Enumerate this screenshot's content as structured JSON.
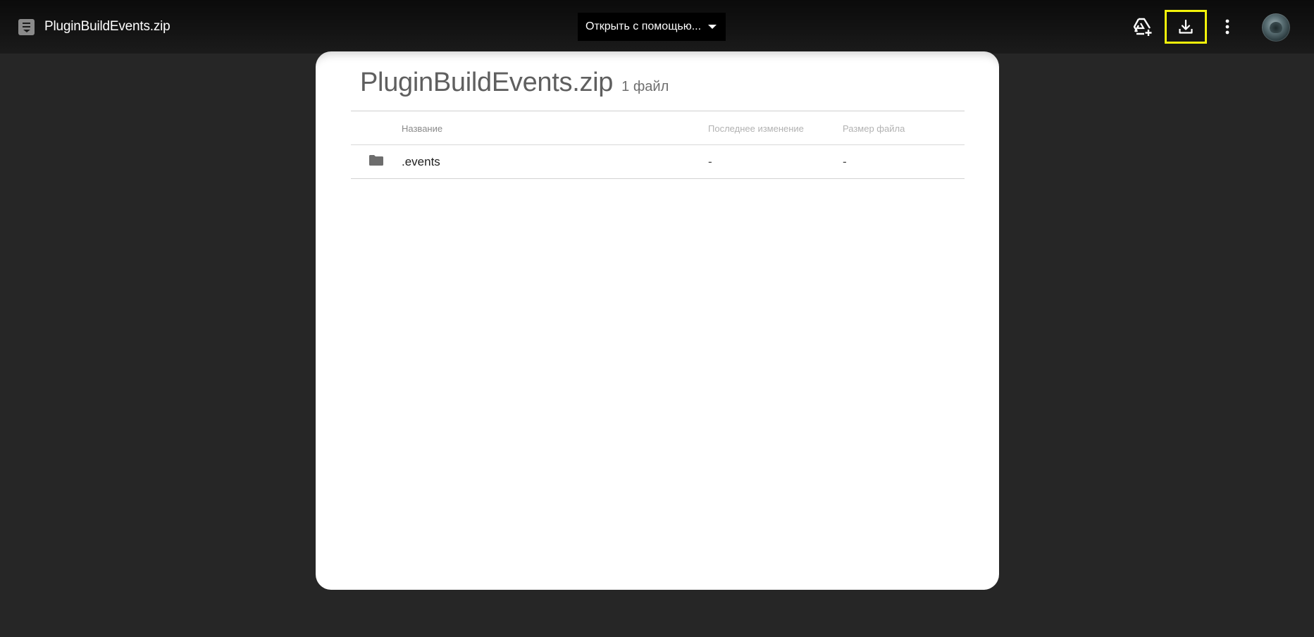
{
  "header": {
    "file_name": "PluginBuildEvents.zip",
    "open_with_label": "Открыть с помощью...",
    "icons": [
      "zip-file-icon",
      "add-to-drive-icon",
      "download-icon",
      "more-vert-icon",
      "avatar"
    ]
  },
  "archive": {
    "title": "PluginBuildEvents.zip",
    "count": "1 файл",
    "columns": {
      "name": "Название",
      "modified": "Последнее изменение",
      "size": "Размер файла"
    },
    "rows": [
      {
        "name": ".events",
        "modified": "-",
        "size": "-",
        "icon": "folder-icon"
      }
    ]
  },
  "colors": {
    "background": "#262626",
    "card": "#ffffff",
    "highlight": "#f2f20a"
  }
}
